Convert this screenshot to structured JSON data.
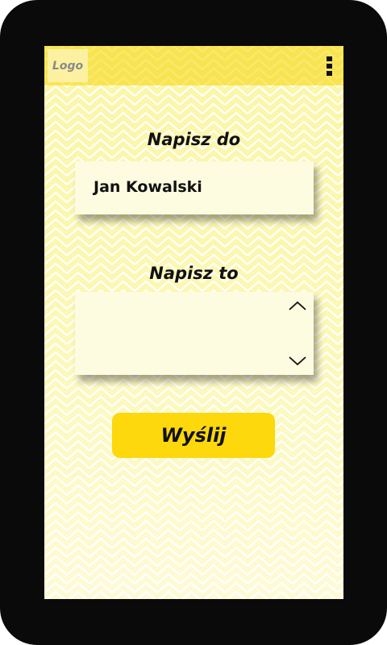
{
  "header": {
    "logo_text": "Logo",
    "menu_icon": "more-vertical-icon"
  },
  "form": {
    "recipient_label": "Napisz do",
    "recipient_value": "Jan Kowalski",
    "message_label": "Napisz to",
    "message_value": "",
    "scroll_up_icon": "chevron-up-icon",
    "scroll_down_icon": "chevron-down-icon",
    "send_label": "Wyślij"
  },
  "colors": {
    "accent": "#fcd80c",
    "topbar": "#f8e451",
    "background": "#fbf6a6",
    "field": "#fdfbe0",
    "frame": "#0a0a0a"
  }
}
